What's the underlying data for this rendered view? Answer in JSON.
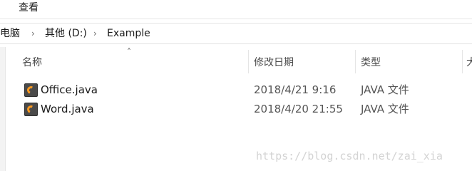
{
  "ribbon": {
    "tab_view": "查看"
  },
  "breadcrumb": {
    "items": [
      "此电脑",
      "其他 (D:)",
      "Example"
    ]
  },
  "columns": {
    "name": "名称",
    "date_modified": "修改日期",
    "type": "类型",
    "size": "大"
  },
  "files": [
    {
      "name": "Office.java",
      "date": "2018/4/21 9:16",
      "type": "JAVA 文件",
      "icon": "sublime-text-file-icon"
    },
    {
      "name": "Word.java",
      "date": "2018/4/20 21:55",
      "type": "JAVA 文件",
      "icon": "sublime-text-file-icon"
    }
  ],
  "watermark": "https://blog.csdn.net/zai_xia"
}
